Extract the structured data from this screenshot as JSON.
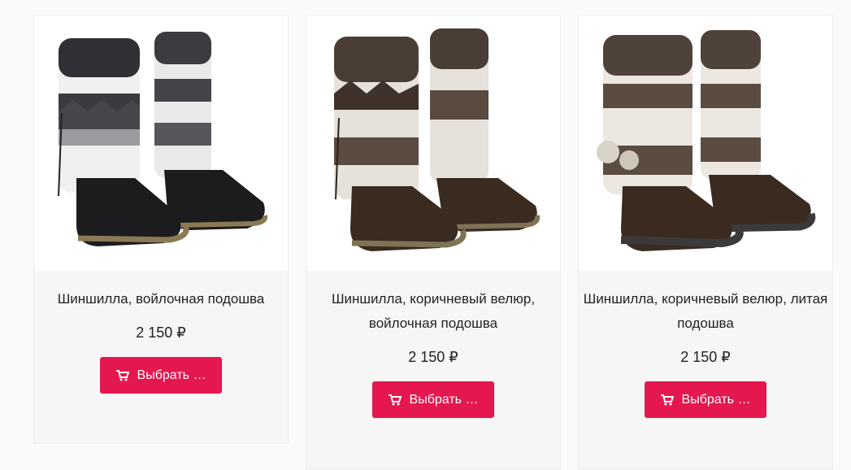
{
  "products": [
    {
      "title": "Шиншилла, войлочная подошва",
      "price": "2 150 ₽",
      "button_label": "Выбрать …",
      "image_icon": "fur-boots-black-image",
      "colors": {
        "fur_dark": "#2f2f35",
        "fur_light": "#f2f2f2",
        "suede": "#1c1c1e",
        "sole": "#8a7a55"
      }
    },
    {
      "title": "Шиншилла, коричневый велюр, войлочная подошва",
      "price": "2 150 ₽",
      "button_label": "Выбрать …",
      "image_icon": "fur-boots-brown-felt-image",
      "colors": {
        "fur_dark": "#4a3d36",
        "fur_light": "#e6e1da",
        "suede": "#3a2b20",
        "sole": "#7f7355"
      }
    },
    {
      "title": "Шиншилла, коричневый велюр, литая подошва",
      "price": "2 150 ₽",
      "button_label": "Выбрать …",
      "image_icon": "fur-boots-brown-cast-image",
      "colors": {
        "fur_dark": "#4f423a",
        "fur_light": "#ece7e1",
        "suede": "#3b2a1f",
        "sole": "#3a3a3c"
      }
    }
  ],
  "accent": "#e5174f"
}
